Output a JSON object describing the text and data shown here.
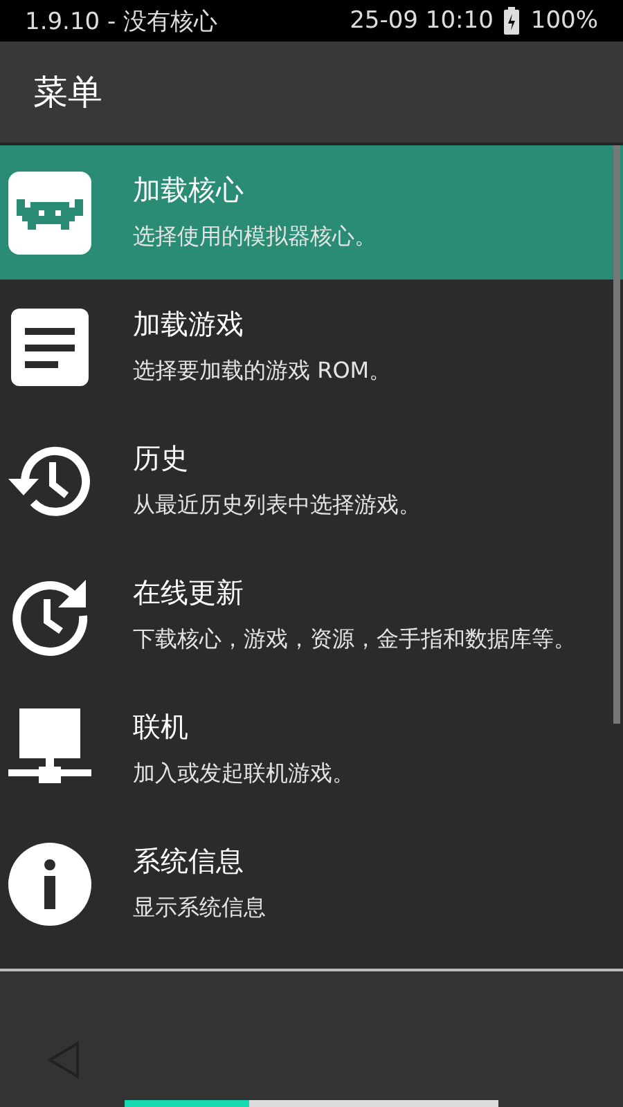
{
  "status_bar": {
    "left": "1.9.10 - 没有核心",
    "time": "25-09 10:10",
    "battery": "100%"
  },
  "app_bar": {
    "title": "菜单"
  },
  "menu": [
    {
      "title": "加载核心",
      "subtitle": "选择使用的模拟器核心。",
      "selected": true
    },
    {
      "title": "加载游戏",
      "subtitle": "选择要加载的游戏 ROM。",
      "selected": false
    },
    {
      "title": "历史",
      "subtitle": "从最近历史列表中选择游戏。",
      "selected": false
    },
    {
      "title": "在线更新",
      "subtitle": "下载核心，游戏，资源，金手指和数据库等。",
      "selected": false
    },
    {
      "title": "联机",
      "subtitle": "加入或发起联机游戏。",
      "selected": false
    },
    {
      "title": "系统信息",
      "subtitle": "显示系统信息",
      "selected": false
    }
  ]
}
